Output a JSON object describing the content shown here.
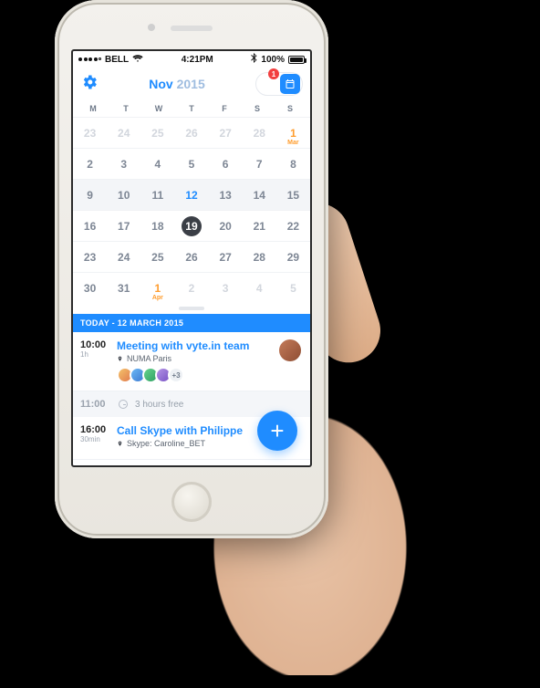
{
  "statusbar": {
    "carrier": "BELL",
    "time": "4:21PM",
    "battery_pct": "100%"
  },
  "header": {
    "month": "Nov",
    "year": "2015",
    "badge_count": "1"
  },
  "weekdays": [
    "M",
    "T",
    "W",
    "T",
    "F",
    "S",
    "S"
  ],
  "calendar_rows": [
    [
      {
        "n": "23",
        "outside": true
      },
      {
        "n": "24",
        "outside": true
      },
      {
        "n": "25",
        "outside": true
      },
      {
        "n": "26",
        "outside": true
      },
      {
        "n": "27",
        "outside": true
      },
      {
        "n": "28",
        "outside": true
      },
      {
        "n": "1",
        "month_start": "Mar"
      }
    ],
    [
      {
        "n": "2"
      },
      {
        "n": "3"
      },
      {
        "n": "4"
      },
      {
        "n": "5"
      },
      {
        "n": "6"
      },
      {
        "n": "7"
      },
      {
        "n": "8"
      }
    ],
    [
      {
        "n": "9",
        "hl": true
      },
      {
        "n": "10",
        "hl": true
      },
      {
        "n": "11",
        "hl": true
      },
      {
        "n": "12",
        "hl": true,
        "selected": true
      },
      {
        "n": "13",
        "hl": true
      },
      {
        "n": "14",
        "hl": true
      },
      {
        "n": "15",
        "hl": true
      }
    ],
    [
      {
        "n": "16"
      },
      {
        "n": "17"
      },
      {
        "n": "18"
      },
      {
        "n": "19",
        "today": true
      },
      {
        "n": "20"
      },
      {
        "n": "21"
      },
      {
        "n": "22"
      }
    ],
    [
      {
        "n": "23"
      },
      {
        "n": "24"
      },
      {
        "n": "25"
      },
      {
        "n": "26"
      },
      {
        "n": "27"
      },
      {
        "n": "28"
      },
      {
        "n": "29"
      }
    ],
    [
      {
        "n": "30"
      },
      {
        "n": "31"
      },
      {
        "n": "1",
        "month_start": "Apr",
        "outside": true
      },
      {
        "n": "2",
        "outside": true
      },
      {
        "n": "3",
        "outside": true
      },
      {
        "n": "4",
        "outside": true
      },
      {
        "n": "5",
        "outside": true
      }
    ]
  ],
  "agenda": {
    "section_label": "TODAY - 12 MARCH 2015",
    "items": [
      {
        "time": "10:00",
        "duration": "1h",
        "title": "Meeting with vyte.in team",
        "location": "NUMA Paris",
        "attendees_extra": "+3"
      },
      {
        "type": "free",
        "time": "11:00",
        "label": "3 hours free"
      },
      {
        "time": "16:00",
        "duration": "30min",
        "title": "Call Skype with Philippe",
        "location": "Skype: Caroline_BET"
      }
    ]
  },
  "fab_label": "+"
}
